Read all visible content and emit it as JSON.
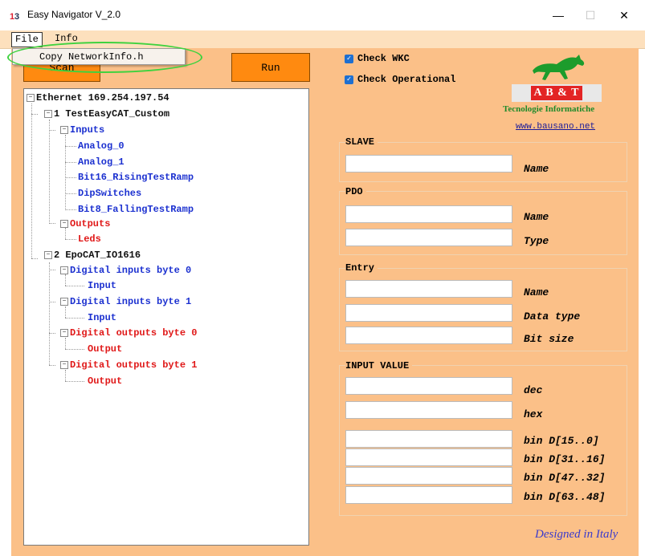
{
  "window": {
    "title": "Easy Navigator V_2.0",
    "minimize": "—",
    "maximize": "☐",
    "close": "✕"
  },
  "menu": {
    "file": "File",
    "info": "Info",
    "dropdown_item": "Copy NetworkInfo.h"
  },
  "buttons": {
    "scan": "Scan",
    "run": "Run"
  },
  "tree": {
    "root": "Ethernet 169.254.197.54",
    "slave1": "1 TestEasyCAT_Custom",
    "inputs": "Inputs",
    "in_items": [
      "Analog_0",
      "Analog_1",
      "Bit16_RisingTestRamp",
      "DipSwitches",
      "Bit8_FallingTestRamp"
    ],
    "outputs": "Outputs",
    "out_items": [
      "Leds"
    ],
    "slave2": "2 EpoCAT_IO1616",
    "s2_groups": [
      {
        "label": "Digital inputs byte 0",
        "child": "Input"
      },
      {
        "label": "Digital inputs byte 1",
        "child": "Input"
      },
      {
        "label": "Digital outputs byte 0",
        "child": "Output"
      },
      {
        "label": "Digital outputs byte 1",
        "child": "Output"
      }
    ]
  },
  "checks": {
    "wkc": "Check WKC",
    "operational": "Check Operational",
    "wkc_checked": true,
    "operational_checked": true
  },
  "logo": {
    "letters": "A B & T",
    "tagline": "Tecnologie Informatiche",
    "url": "www.bausano.net",
    "icon": "horse-icon"
  },
  "groups": {
    "slave": {
      "title": "SLAVE",
      "name_label": "Name"
    },
    "pdo": {
      "title": "PDO",
      "name_label": "Name",
      "type_label": "Type"
    },
    "entry": {
      "title": "Entry",
      "name_label": "Name",
      "datatype_label": "Data type",
      "bitsize_label": "Bit size"
    },
    "input_value": {
      "title": "INPUT VALUE",
      "dec_label": "dec",
      "hex_label": "hex",
      "bin_labels": [
        "bin D[15..0]",
        "bin D[31..16]",
        "bin D[47..32]",
        "bin D[63..48]"
      ]
    }
  },
  "footer": {
    "designed": "Designed in Italy"
  },
  "colors": {
    "background": "#fbc088",
    "button": "#ff8a10",
    "tree_blue": "#1c31d0",
    "tree_red": "#e01818",
    "highlight": "#3fd23f"
  }
}
